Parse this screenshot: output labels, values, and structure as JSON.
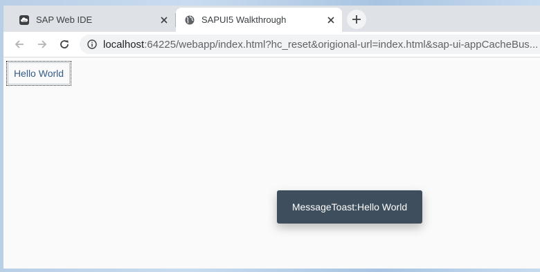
{
  "tabs": [
    {
      "title": "SAP Web IDE",
      "favicon": "sap-webide-icon",
      "active": false
    },
    {
      "title": "SAPUI5 Walkthrough",
      "favicon": "globe-icon",
      "active": true
    }
  ],
  "toolbar": {
    "url_host": "localhost",
    "url_rest": ":64225/webapp/index.html?hc_reset&origional-url=index.html&sap-ui-appCacheBus..."
  },
  "page": {
    "button_label": "Hello World",
    "toast_text": "MessageToast:Hello World"
  },
  "colors": {
    "toast_bg": "#3f4e5d",
    "button_text": "#345b8a"
  }
}
